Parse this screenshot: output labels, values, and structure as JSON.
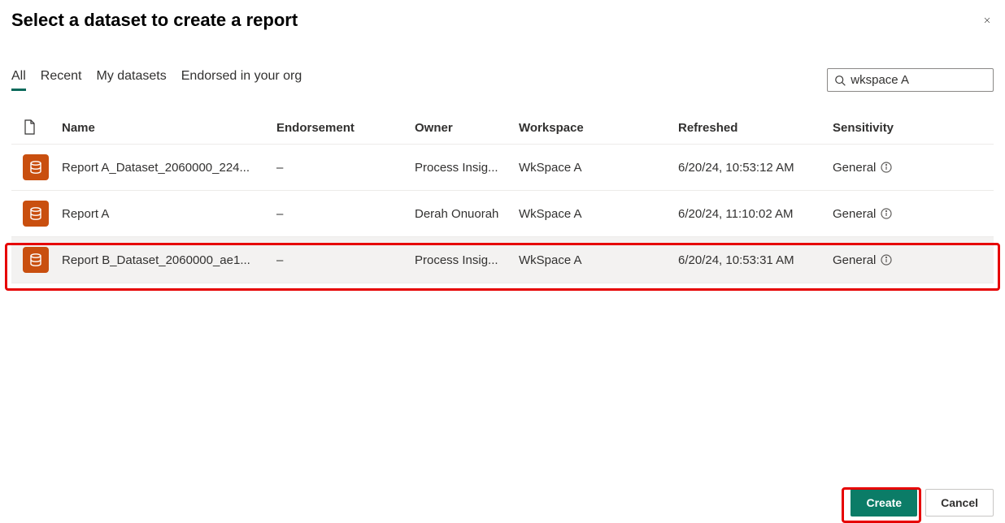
{
  "dialog": {
    "title": "Select a dataset to create a report"
  },
  "tabs": {
    "items": [
      {
        "label": "All",
        "active": true
      },
      {
        "label": "Recent",
        "active": false
      },
      {
        "label": "My datasets",
        "active": false
      },
      {
        "label": "Endorsed in your org",
        "active": false
      }
    ]
  },
  "search": {
    "value": "wkspace A"
  },
  "table": {
    "headers": {
      "name": "Name",
      "endorsement": "Endorsement",
      "owner": "Owner",
      "workspace": "Workspace",
      "refreshed": "Refreshed",
      "sensitivity": "Sensitivity"
    },
    "rows": [
      {
        "name": "Report A_Dataset_2060000_224...",
        "endorsement": "–",
        "owner": "Process Insig...",
        "workspace": "WkSpace A",
        "refreshed": "6/20/24, 10:53:12 AM",
        "sensitivity": "General",
        "selected": false
      },
      {
        "name": "Report A",
        "endorsement": "–",
        "owner": "Derah Onuorah",
        "workspace": "WkSpace A",
        "refreshed": "6/20/24, 11:10:02 AM",
        "sensitivity": "General",
        "selected": false
      },
      {
        "name": "Report B_Dataset_2060000_ae1...",
        "endorsement": "–",
        "owner": "Process Insig...",
        "workspace": "WkSpace A",
        "refreshed": "6/20/24, 10:53:31 AM",
        "sensitivity": "General",
        "selected": true
      }
    ]
  },
  "footer": {
    "create": "Create",
    "cancel": "Cancel"
  }
}
